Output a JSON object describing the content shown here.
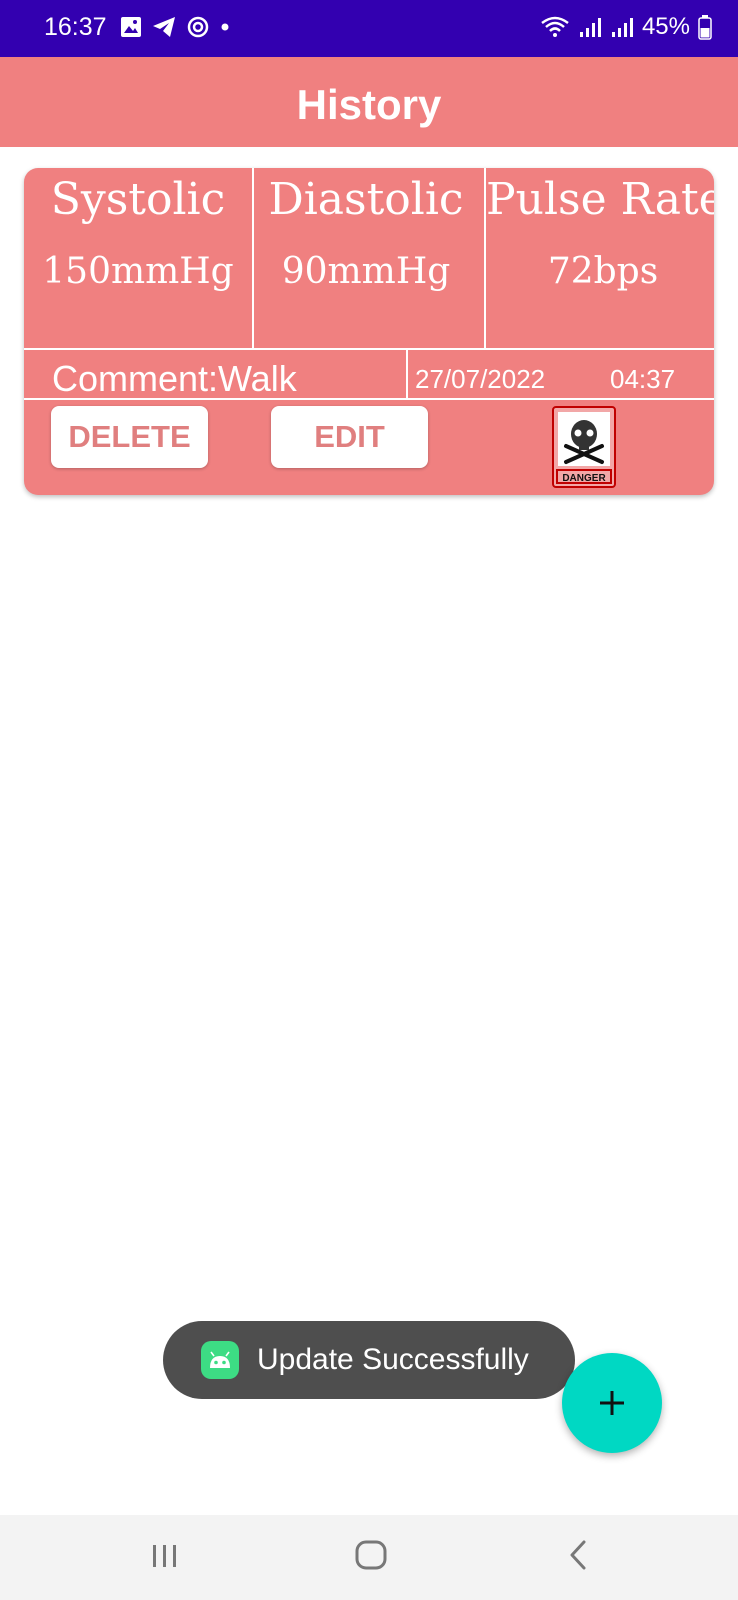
{
  "status_bar": {
    "time": "16:37",
    "battery": "45%"
  },
  "app_bar": {
    "title": "History"
  },
  "record": {
    "systolic_label": "Systolic",
    "diastolic_label": "Diastolic",
    "pulse_label": "Pulse Rate",
    "systolic_value": "150mmHg",
    "diastolic_value": "90mmHg",
    "pulse_value": "72bps",
    "comment": "Comment:Walk",
    "date": "27/07/2022",
    "time": "04:37",
    "delete_label": "DELETE",
    "edit_label": "EDIT",
    "status_icon": "danger-icon",
    "danger_text": "DANGER"
  },
  "toast": {
    "message": "Update Successfully"
  },
  "fab": {
    "icon": "plus-icon"
  },
  "colors": {
    "status_bar": "#3300b0",
    "primary": "#f08080",
    "fab": "#00d8c3",
    "toast": "#4e4e4e"
  }
}
